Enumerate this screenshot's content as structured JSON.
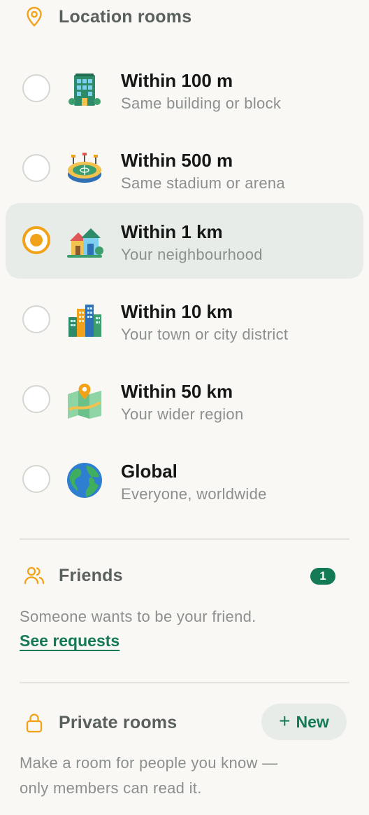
{
  "location_rooms": {
    "title": "Location rooms",
    "header_icon": "location-pin-icon",
    "options": [
      {
        "title": "Within 100 m",
        "subtitle": "Same building or block",
        "icon": "office-building-icon",
        "selected": false
      },
      {
        "title": "Within 500 m",
        "subtitle": "Same stadium or arena",
        "icon": "stadium-icon",
        "selected": false
      },
      {
        "title": "Within 1 km",
        "subtitle": "Your neighbourhood",
        "icon": "houses-icon",
        "selected": true
      },
      {
        "title": "Within 10 km",
        "subtitle": "Your town or city district",
        "icon": "city-skyline-icon",
        "selected": false
      },
      {
        "title": "Within 50 km",
        "subtitle": "Your wider region",
        "icon": "map-pin-icon",
        "selected": false
      },
      {
        "title": "Global",
        "subtitle": "Everyone, worldwide",
        "icon": "globe-icon",
        "selected": false
      }
    ]
  },
  "friends": {
    "title": "Friends",
    "header_icon": "people-icon",
    "badge_count": "1",
    "message": "Someone wants to be your friend.",
    "link_label": "See requests"
  },
  "private_rooms": {
    "title": "Private rooms",
    "header_icon": "lock-icon",
    "new_button_label": "New",
    "description_line1": "Make a room for people you know —",
    "description_line2": "only members can read it."
  },
  "colors": {
    "accent_orange": "#f2a218",
    "brand_green": "#137a55",
    "background": "#f9f8f4",
    "selected_row": "#e7ece8"
  }
}
